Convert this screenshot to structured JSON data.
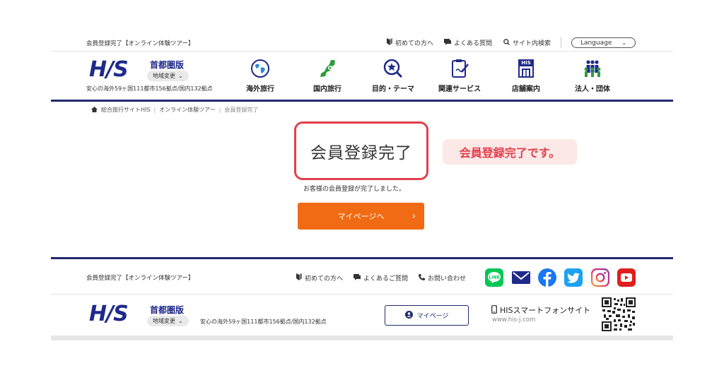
{
  "header": {
    "page_title": "会員登録完了【オンライン体験ツアー】",
    "utility_links": [
      {
        "label": "初めての方へ",
        "icon": "beginner-mark-icon"
      },
      {
        "label": "よくある質問",
        "icon": "chat-icon"
      },
      {
        "label": "サイト内検索",
        "icon": "search-icon"
      }
    ],
    "language_label": "Language"
  },
  "brand": {
    "logo": "H/S",
    "area_name": "首都圏版",
    "area_change": "地域変更",
    "tagline": "安心の海外59ヶ国111都市156拠点/国内132拠点"
  },
  "nav": {
    "items": [
      {
        "label": "海外旅行",
        "icon": "globe-icon"
      },
      {
        "label": "国内旅行",
        "icon": "japan-map-icon"
      },
      {
        "label": "目的・テーマ",
        "icon": "star-search-icon"
      },
      {
        "label": "関連サービス",
        "icon": "clipboard-pen-icon"
      },
      {
        "label": "店舗案内",
        "icon": "his-store-icon"
      },
      {
        "label": "法人・団体",
        "icon": "group-people-icon"
      }
    ]
  },
  "breadcrumb": {
    "items": [
      "総合旅行サイトHIS",
      "オンライン体験ツアー",
      "会員登録完了"
    ]
  },
  "main": {
    "title": "会員登録完了",
    "callout": "会員登録完了です。",
    "message": "お客様の会員登録が完了しました。",
    "mypage_button": "マイページへ"
  },
  "footer": {
    "page_title": "会員登録完了【オンライン体験ツアー】",
    "links": [
      {
        "label": "初めての方へ",
        "icon": "beginner-mark-icon"
      },
      {
        "label": "よくあるご質問",
        "icon": "chat-icon"
      },
      {
        "label": "お問い合わせ",
        "icon": "phone-icon"
      }
    ],
    "social": [
      {
        "name": "line-icon",
        "color": "#06c755",
        "label": "LINE"
      },
      {
        "name": "mail-icon",
        "color": "#1f2a8a"
      },
      {
        "name": "facebook-icon",
        "color": "#1877f2"
      },
      {
        "name": "twitter-icon",
        "color": "#1da1f2"
      },
      {
        "name": "instagram-icon",
        "color": "#c13584"
      },
      {
        "name": "youtube-icon",
        "color": "#e01e1e"
      }
    ],
    "mypage_label": "マイページ",
    "smartphone_title": "HISスマートフォンサイト",
    "smartphone_url": "www.his-j.com"
  },
  "colors": {
    "brand_navy": "#1f2a8a",
    "accent_orange": "#f06b13",
    "highlight_red": "#e0404d",
    "callout_bg": "#fce8e6"
  }
}
